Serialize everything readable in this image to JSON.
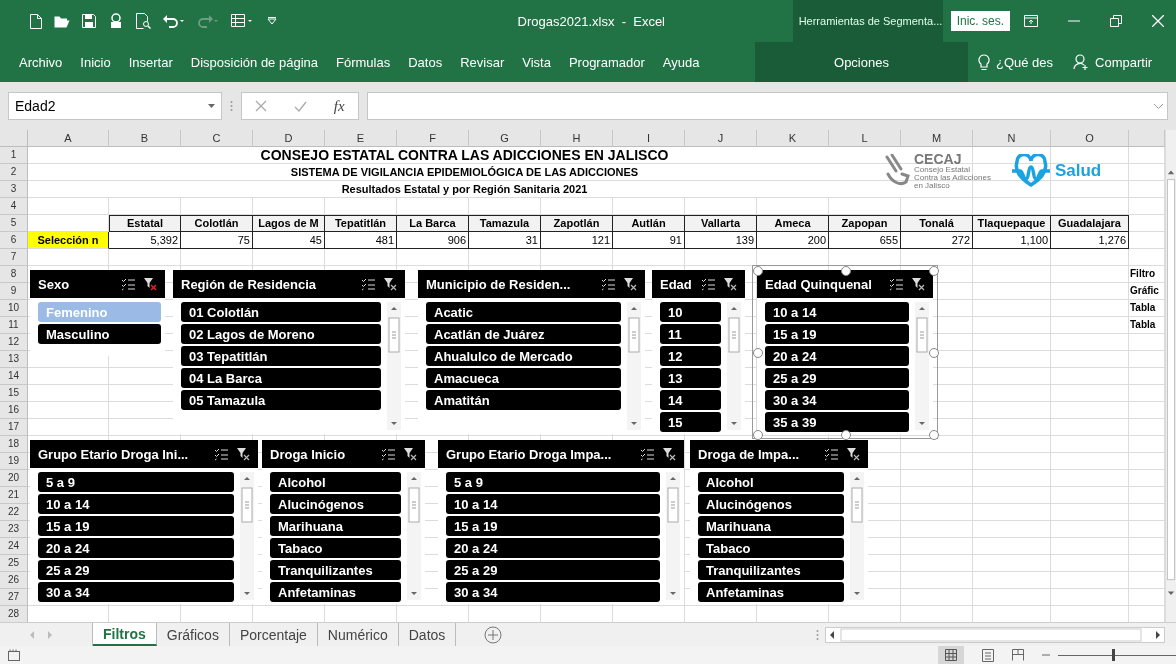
{
  "window": {
    "title": "Drogas2021.xlsx  -  Excel",
    "context_group": "Herramientas de Segmenta...",
    "sign_in": "Inic. ses."
  },
  "ribbon_tabs": [
    {
      "label": "Archivo",
      "kind": "standard"
    },
    {
      "label": "Inicio",
      "kind": "standard"
    },
    {
      "label": "Insertar",
      "kind": "standard"
    },
    {
      "label": "Disposición de página",
      "kind": "standard"
    },
    {
      "label": "Fórmulas",
      "kind": "standard"
    },
    {
      "label": "Datos",
      "kind": "standard"
    },
    {
      "label": "Revisar",
      "kind": "standard"
    },
    {
      "label": "Vista",
      "kind": "standard"
    },
    {
      "label": "Programador",
      "kind": "standard"
    },
    {
      "label": "Ayuda",
      "kind": "standard"
    },
    {
      "label": "Opciones",
      "kind": "context"
    }
  ],
  "tell_me": "¿Qué des",
  "share": "Compartir",
  "formula_bar": {
    "name_box": "Edad2",
    "function_label": "fx"
  },
  "sheet": {
    "column_letters": [
      "A",
      "B",
      "C",
      "D",
      "E",
      "F",
      "G",
      "H",
      "I",
      "J",
      "K",
      "L",
      "M",
      "N",
      "O"
    ],
    "row_numbers": [
      "1",
      "2",
      "3",
      "4",
      "5",
      "6",
      "7",
      "8",
      "9",
      "10",
      "11",
      "12",
      "13",
      "14",
      "15",
      "16",
      "17",
      "18",
      "19",
      "20",
      "21",
      "22",
      "23",
      "24",
      "25",
      "26",
      "27",
      "28"
    ],
    "title_lines": [
      "CONSEJO ESTATAL CONTRA LAS ADICCIONES EN JALISCO",
      "SISTEMA DE VIGILANCIA EPIDEMIOLÓGICA DE LAS ADICCIONES",
      "Resultados Estatal y por Región Sanitaria 2021"
    ],
    "header_row": [
      "Estatal",
      "Colotlán",
      "Lagos de M",
      "Tepatitlán",
      "La Barca",
      "Tamazula",
      "Zapotlán",
      "Autlán",
      "Vallarta",
      "Ameca",
      "Zapopan",
      "Tonalá",
      "Tlaquepaque",
      "Guadalajara"
    ],
    "row_label": "Selección n",
    "values": [
      "5,392",
      "75",
      "45",
      "481",
      "906",
      "31",
      "121",
      "91",
      "139",
      "200",
      "655",
      "272",
      "1,100",
      "1,276"
    ],
    "side_notes": [
      "Filtro",
      "Gráfic",
      "Tabla",
      "Tabla"
    ]
  },
  "logos": {
    "cecaj_name": "CECAJ",
    "cecaj_lines": [
      "Consejo Estatal",
      "Contra las Adicciones",
      "en Jalisco"
    ],
    "salud": "Salud"
  },
  "slicers": [
    {
      "title": "Sexo",
      "filtered": true,
      "selected": false,
      "items": [
        {
          "label": "Femenino",
          "selected": false
        },
        {
          "label": "Masculino",
          "selected": true
        }
      ]
    },
    {
      "title": "Región de Residencia",
      "filtered": false,
      "selected": false,
      "items": [
        {
          "label": "01 Colotlán",
          "selected": true
        },
        {
          "label": "02 Lagos de Moreno",
          "selected": true
        },
        {
          "label": "03 Tepatitlán",
          "selected": true
        },
        {
          "label": "04 La Barca",
          "selected": true
        },
        {
          "label": "05 Tamazula",
          "selected": true
        }
      ]
    },
    {
      "title": "Municipio de Residen...",
      "filtered": false,
      "selected": false,
      "items": [
        {
          "label": "Acatic",
          "selected": true
        },
        {
          "label": "Acatlán de Juárez",
          "selected": true
        },
        {
          "label": "Ahualulco de Mercado",
          "selected": true
        },
        {
          "label": "Amacueca",
          "selected": true
        },
        {
          "label": "Amatitán",
          "selected": true
        }
      ]
    },
    {
      "title": "Edad",
      "filtered": false,
      "selected": false,
      "items": [
        {
          "label": "10",
          "selected": true
        },
        {
          "label": "11",
          "selected": true
        },
        {
          "label": "12",
          "selected": true
        },
        {
          "label": "13",
          "selected": true
        },
        {
          "label": "14",
          "selected": true
        },
        {
          "label": "15",
          "selected": true
        }
      ]
    },
    {
      "title": "Edad Quinquenal",
      "filtered": false,
      "selected": true,
      "items": [
        {
          "label": "10 a 14",
          "selected": true
        },
        {
          "label": "15 a 19",
          "selected": true
        },
        {
          "label": "20 a 24",
          "selected": true
        },
        {
          "label": "25 a 29",
          "selected": true
        },
        {
          "label": "30 a 34",
          "selected": true
        },
        {
          "label": "35 a 39",
          "selected": true
        }
      ]
    },
    {
      "title": "Grupo Etario Droga Ini...",
      "filtered": false,
      "selected": false,
      "items": [
        {
          "label": "5 a 9",
          "selected": true
        },
        {
          "label": "10 a 14",
          "selected": true
        },
        {
          "label": "15 a 19",
          "selected": true
        },
        {
          "label": "20 a 24",
          "selected": true
        },
        {
          "label": "25 a 29",
          "selected": true
        },
        {
          "label": "30 a 34",
          "selected": true
        }
      ]
    },
    {
      "title": "Droga Inicio",
      "filtered": false,
      "selected": false,
      "items": [
        {
          "label": "Alcohol",
          "selected": true
        },
        {
          "label": "Alucinógenos",
          "selected": true
        },
        {
          "label": "Marihuana",
          "selected": true
        },
        {
          "label": "Tabaco",
          "selected": true
        },
        {
          "label": "Tranquilizantes",
          "selected": true
        },
        {
          "label": "Anfetaminas",
          "selected": true
        }
      ]
    },
    {
      "title": "Grupo Etario Droga Impa...",
      "filtered": false,
      "selected": false,
      "items": [
        {
          "label": "5 a 9",
          "selected": true
        },
        {
          "label": "10 a 14",
          "selected": true
        },
        {
          "label": "15 a 19",
          "selected": true
        },
        {
          "label": "20 a 24",
          "selected": true
        },
        {
          "label": "25 a 29",
          "selected": true
        },
        {
          "label": "30 a 34",
          "selected": true
        }
      ]
    },
    {
      "title": "Droga de Impa...",
      "filtered": false,
      "selected": false,
      "items": [
        {
          "label": "Alcohol",
          "selected": true
        },
        {
          "label": "Alucinógenos",
          "selected": true
        },
        {
          "label": "Marihuana",
          "selected": true
        },
        {
          "label": "Tabaco",
          "selected": true
        },
        {
          "label": "Tranquilizantes",
          "selected": true
        },
        {
          "label": "Anfetaminas",
          "selected": true
        }
      ]
    }
  ],
  "zoom_slider": {
    "level": 0.47
  },
  "sheet_tabs": [
    {
      "label": "Filtros",
      "selected": true
    },
    {
      "label": "Gráficos",
      "selected": false
    },
    {
      "label": "Porcentaje",
      "selected": false
    },
    {
      "label": "Numérico",
      "selected": false
    },
    {
      "label": "Datos",
      "selected": false
    }
  ]
}
